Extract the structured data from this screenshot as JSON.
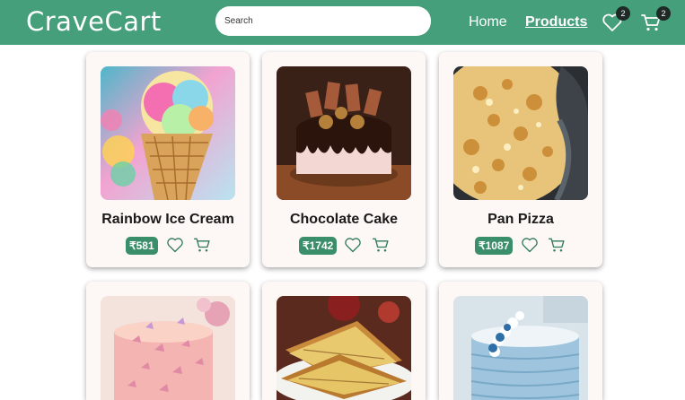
{
  "header": {
    "brand": "CraveCart",
    "search_placeholder": "Search",
    "nav": {
      "home": "Home",
      "products": "Products"
    },
    "wishlist_count": "2",
    "cart_count": "2",
    "icons": {
      "wishlist": "heart-icon",
      "cart": "cart-icon"
    }
  },
  "products": [
    {
      "name": "Rainbow Ice Cream",
      "price": "₹581"
    },
    {
      "name": "Chocolate Cake",
      "price": "₹1742"
    },
    {
      "name": "Pan Pizza",
      "price": "₹1087"
    },
    {
      "name": "",
      "price": ""
    },
    {
      "name": "",
      "price": ""
    },
    {
      "name": "",
      "price": ""
    }
  ],
  "colors": {
    "brand_green": "#449f7a",
    "price_badge": "#3a8f6a",
    "card_bg": "#fdf7f6"
  }
}
